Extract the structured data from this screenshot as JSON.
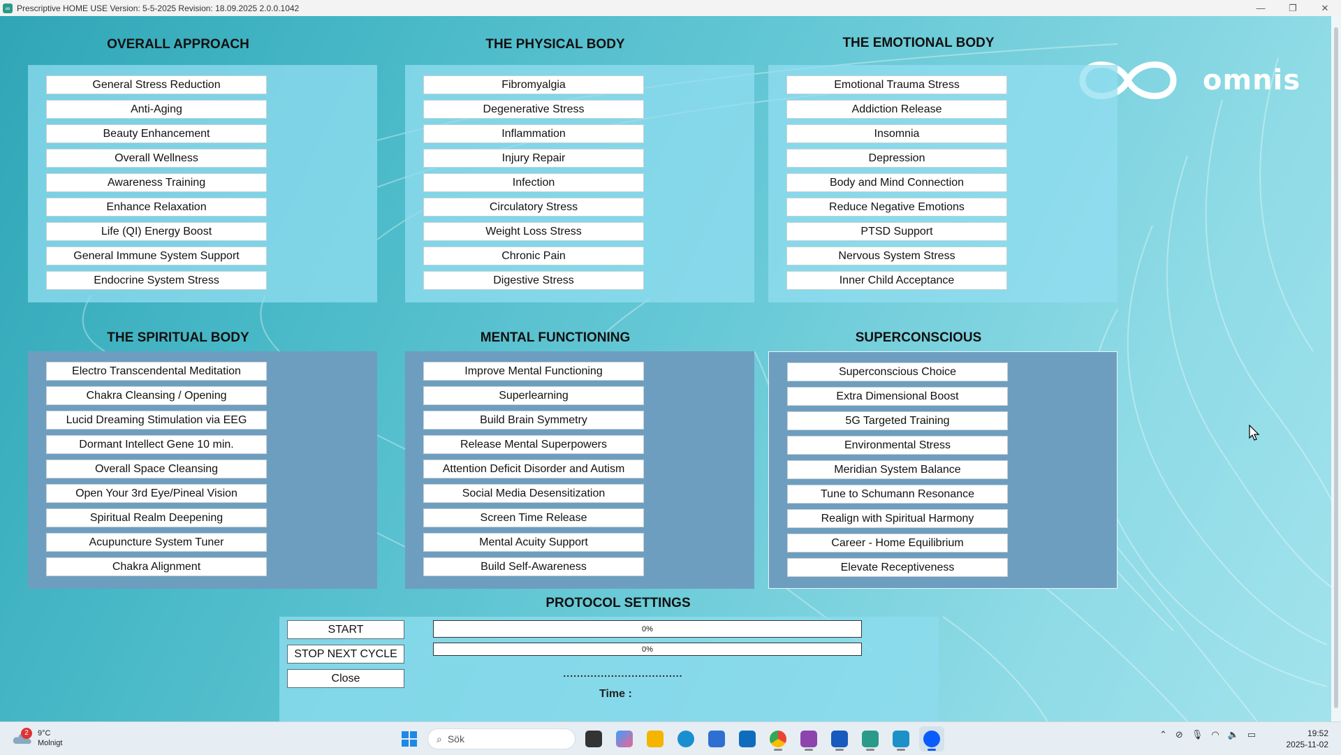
{
  "window": {
    "title": "Prescriptive HOME USE Version: 5-5-2025 Revision: 18.09.2025 2.0.0.1042",
    "controls": [
      "—",
      "❐",
      "✕"
    ]
  },
  "logo": {
    "text": "omnis"
  },
  "sections": {
    "overall": {
      "title": "OVERALL APPROACH",
      "items": [
        "General Stress Reduction",
        "Anti-Aging",
        "Beauty Enhancement",
        "Overall Wellness",
        "Awareness Training",
        "Enhance Relaxation",
        "Life (QI) Energy Boost",
        "General Immune System Support",
        "Endocrine System Stress"
      ]
    },
    "physical": {
      "title": "THE PHYSICAL BODY",
      "items": [
        "Fibromyalgia",
        "Degenerative Stress",
        "Inflammation",
        "Injury Repair",
        "Infection",
        "Circulatory Stress",
        "Weight Loss Stress",
        "Chronic Pain",
        "Digestive Stress"
      ]
    },
    "emotional": {
      "title": "THE EMOTIONAL BODY",
      "items": [
        "Emotional Trauma Stress",
        "Addiction Release",
        "Insomnia",
        "Depression",
        "Body and Mind Connection",
        "Reduce Negative Emotions",
        "PTSD Support",
        "Nervous System Stress",
        "Inner Child Acceptance"
      ]
    },
    "spiritual": {
      "title": "THE SPIRITUAL BODY",
      "items": [
        "Electro Transcendental Meditation",
        "Chakra Cleansing / Opening",
        "Lucid Dreaming Stimulation via EEG",
        "Dormant Intellect Gene 10 min.",
        "Overall Space Cleansing",
        "Open Your 3rd Eye/Pineal Vision",
        "Spiritual Realm Deepening",
        "Acupuncture System Tuner",
        "Chakra Alignment"
      ]
    },
    "mental": {
      "title": "MENTAL FUNCTIONING",
      "items": [
        "Improve Mental Functioning",
        "Superlearning",
        "Build Brain Symmetry",
        "Release Mental Superpowers",
        "Attention Deficit Disorder and Autism",
        "Social Media Desensitization",
        "Screen Time Release",
        "Mental Acuity Support",
        "Build Self-Awareness"
      ]
    },
    "superconscious": {
      "title": "SUPERCONSCIOUS",
      "items": [
        "Superconscious Choice",
        "Extra Dimensional Boost",
        "5G Targeted Training",
        "Environmental Stress",
        "Meridian System Balance",
        "Tune to Schumann Resonance",
        "Realign with Spiritual Harmony",
        "Career - Home Equilibrium",
        "Elevate Receptiveness"
      ]
    }
  },
  "protocol": {
    "title": "PROTOCOL SETTINGS",
    "start_label": "START",
    "stop_label": "STOP NEXT CYCLE",
    "close_label": "Close",
    "progress1": {
      "label": "0%",
      "fraction": 0
    },
    "progress2": {
      "label": "0%",
      "fraction": 0
    },
    "dots": "...................................",
    "time_label": "Time :"
  },
  "taskbar": {
    "weather": {
      "temp": "9°C",
      "condition": "Molnigt",
      "badge": "2"
    },
    "search_placeholder": "Sök",
    "clock": {
      "time": "19:52",
      "date": "2025-11-02"
    }
  },
  "colors": {
    "light_panel": "#91ddf0",
    "dark_panel": "#6e9ebf",
    "background": "#4fb8c8"
  }
}
